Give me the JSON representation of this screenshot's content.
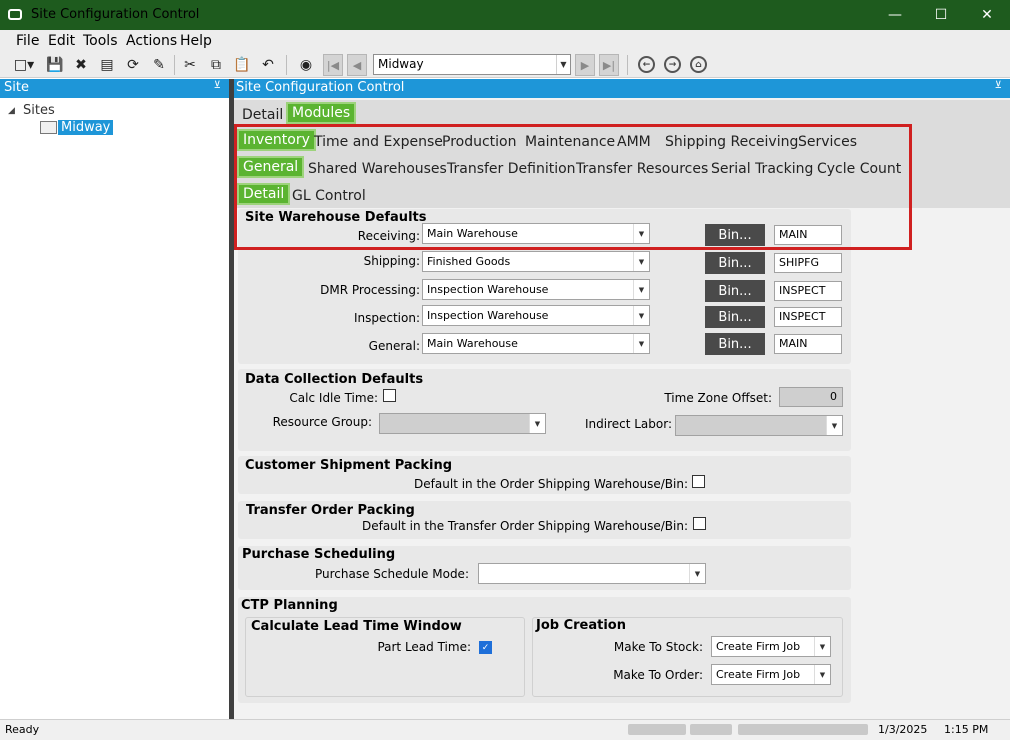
{
  "window": {
    "title": "Site Configuration Control"
  },
  "menu": [
    "File",
    "Edit",
    "Tools",
    "Actions",
    "Help"
  ],
  "toolbar": {
    "site_value": "Midway"
  },
  "left_panel": {
    "header": "Site",
    "tree_root": "Sites",
    "tree_item": "Midway"
  },
  "right_panel": {
    "header": "Site Configuration Control"
  },
  "tabs_l1": [
    "Detail",
    "Modules"
  ],
  "tabs_l2": [
    "Inventory",
    "Time and Expense",
    "Production",
    "Maintenance",
    "AMM",
    "Shipping Receiving",
    "Services"
  ],
  "tabs_l3": [
    "General",
    "Shared Warehouses",
    "Transfer Definition",
    "Transfer Resources",
    "Serial Tracking",
    "Cycle Count"
  ],
  "tabs_l4": [
    "Detail",
    "GL Control"
  ],
  "site_warehouse": {
    "title": "Site Warehouse Defaults",
    "bin_label": "Bin...",
    "rows": [
      {
        "label": "Receiving:",
        "value": "Main Warehouse",
        "bin": "MAIN"
      },
      {
        "label": "Shipping:",
        "value": "Finished Goods",
        "bin": "SHIPFG"
      },
      {
        "label": "DMR Processing:",
        "value": "Inspection Warehouse",
        "bin": "INSPECT"
      },
      {
        "label": "Inspection:",
        "value": "Inspection Warehouse",
        "bin": "INSPECT"
      },
      {
        "label": "General:",
        "value": "Main Warehouse",
        "bin": "MAIN"
      }
    ]
  },
  "data_collection": {
    "title": "Data Collection Defaults",
    "calc_idle_label": "Calc Idle Time:",
    "calc_idle_checked": false,
    "tz_label": "Time Zone Offset:",
    "tz_value": "0",
    "resource_group_label": "Resource Group:",
    "indirect_labor_label": "Indirect Labor:"
  },
  "customer_shipment": {
    "title": "Customer Shipment Packing",
    "label": "Default in the Order Shipping Warehouse/Bin:",
    "checked": false
  },
  "transfer_order": {
    "title": "Transfer Order Packing",
    "label": "Default in the Transfer Order Shipping Warehouse/Bin:",
    "checked": false
  },
  "purchase_scheduling": {
    "title": "Purchase Scheduling",
    "label": "Purchase Schedule Mode:",
    "value": ""
  },
  "ctp": {
    "title": "CTP Planning",
    "lead_title": "Calculate Lead Time Window",
    "part_lead_label": "Part Lead Time:",
    "part_lead_checked": true,
    "job_title": "Job Creation",
    "mts_label": "Make To Stock:",
    "mts_value": "Create Firm Job",
    "mto_label": "Make To Order:",
    "mto_value": "Create Firm Job"
  },
  "status": {
    "text": "Ready",
    "date": "1/3/2025",
    "time": "1:15 PM"
  },
  "colors": {
    "title_bar": "#1e5b1e",
    "accent_blue": "#1e96d8",
    "tab_green": "#5bb431",
    "highlight_red": "#d02020"
  }
}
